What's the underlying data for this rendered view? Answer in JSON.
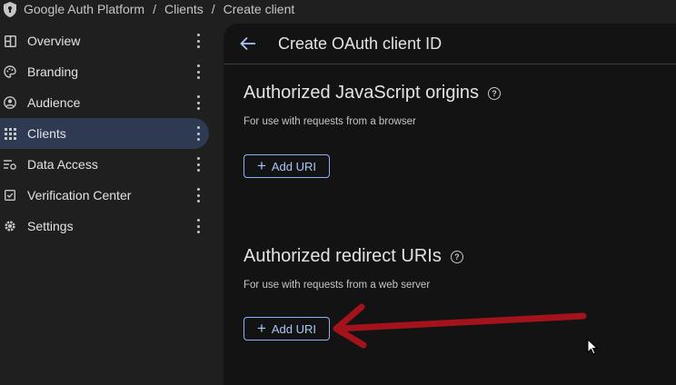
{
  "breadcrumb": {
    "app": "Google Auth Platform",
    "section": "Clients",
    "page": "Create client"
  },
  "sidebar": {
    "items": [
      {
        "label": "Overview",
        "icon": "dashboard-icon"
      },
      {
        "label": "Branding",
        "icon": "palette-icon"
      },
      {
        "label": "Audience",
        "icon": "person-icon"
      },
      {
        "label": "Clients",
        "icon": "grid-icon",
        "active": true
      },
      {
        "label": "Data Access",
        "icon": "data-access-icon"
      },
      {
        "label": "Verification Center",
        "icon": "verification-icon"
      },
      {
        "label": "Settings",
        "icon": "gear-icon"
      }
    ]
  },
  "main": {
    "title": "Create OAuth client ID",
    "js_origins": {
      "title": "Authorized JavaScript origins",
      "subtitle": "For use with requests from a browser",
      "button": "Add URI"
    },
    "redirect_uris": {
      "title": "Authorized redirect URIs",
      "subtitle": "For use with requests from a web server",
      "button": "Add URI"
    }
  },
  "colors": {
    "accent": "#8ab4f8",
    "active_nav": "#2d3a52",
    "annotation_arrow": "#a3131b"
  }
}
